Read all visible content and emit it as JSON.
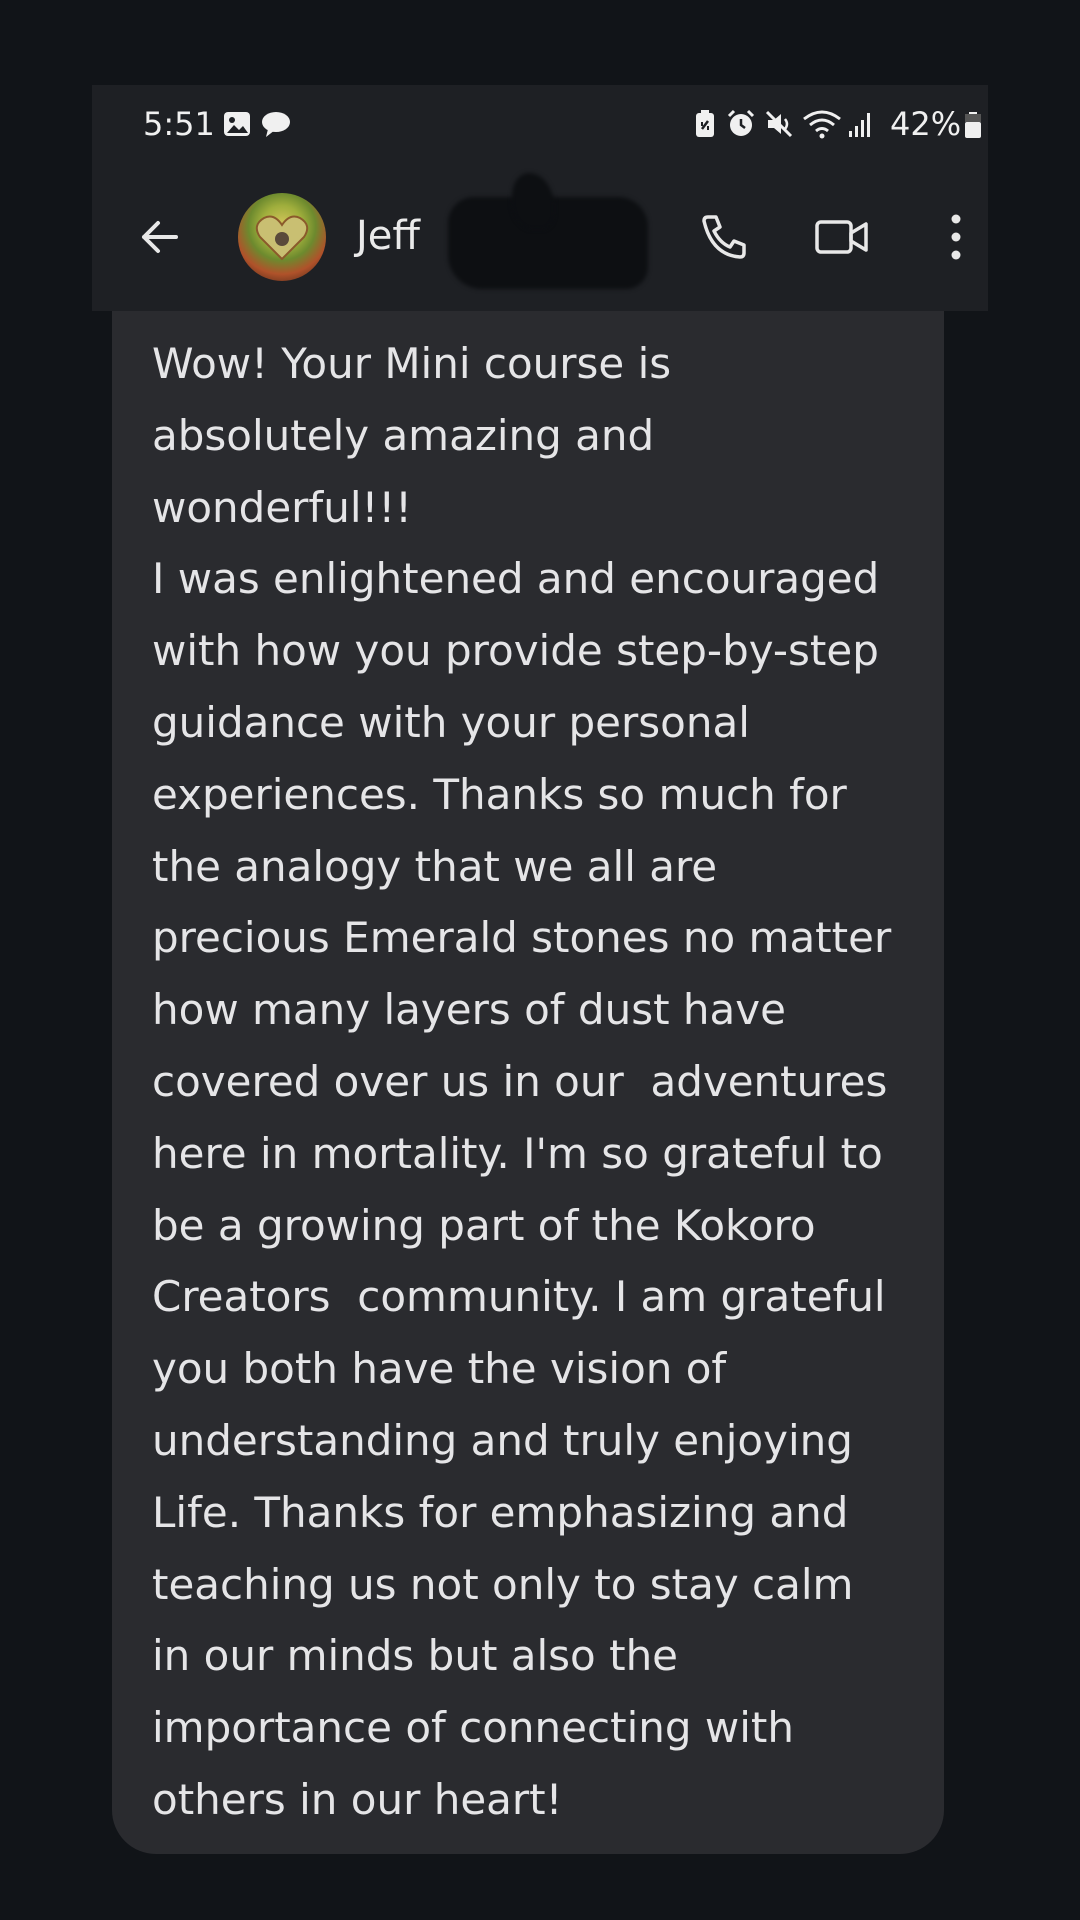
{
  "status_bar": {
    "time": "5:51",
    "battery_percent": "42%",
    "left_icons": [
      "gallery-icon",
      "chat-bubble-icon"
    ],
    "right_icons": [
      "battery-saver-icon",
      "alarm-icon",
      "mute-icon",
      "wifi-icon",
      "signal-icon",
      "battery-icon"
    ]
  },
  "header": {
    "back_icon": "arrow-left-icon",
    "contact_name": "Jeff",
    "name_redacted": true,
    "actions": [
      "phone-icon",
      "video-call-icon",
      "more-vert-icon"
    ]
  },
  "message": {
    "lines": [
      "Wow! Your Mini course is",
      "absolutely amazing and",
      "wonderful!!!",
      "I was enlightened and encouraged",
      "with how you provide step-by-step",
      "guidance with your personal",
      "experiences. Thanks so much for",
      "the analogy that we all are",
      "precious Emerald stones no matter",
      "how many layers of dust have",
      "covered over us in our  adventures",
      "here in mortality. I'm so grateful to",
      "be a growing part of the Kokoro",
      "Creators  community. I am grateful",
      "you both have the vision of",
      "understanding and truly enjoying",
      "Life. Thanks for emphasizing and",
      "teaching us not only to stay calm",
      "in our minds but also the",
      "importance of connecting with",
      "others in our heart!"
    ]
  },
  "colors": {
    "page_background": "#111418",
    "header_background": "#1e2024",
    "bubble_background": "#2a2b2f",
    "text": "#e5e5e7"
  }
}
